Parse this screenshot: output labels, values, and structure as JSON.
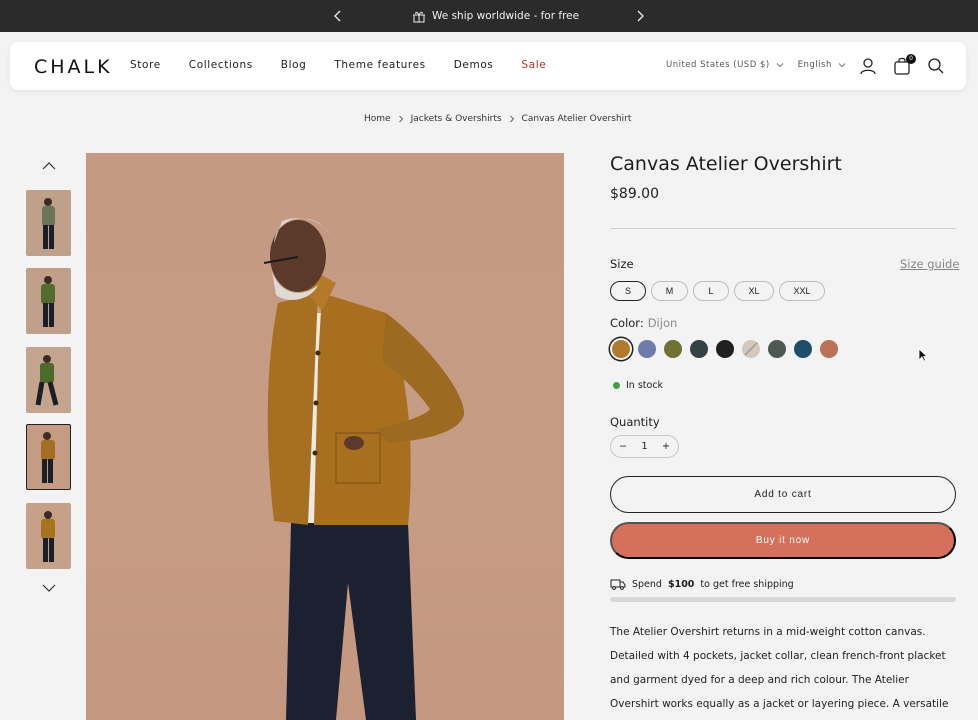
{
  "announcement": {
    "text": "We ship worldwide - for free"
  },
  "header": {
    "logo": "CHALK",
    "nav": [
      "Store",
      "Collections",
      "Blog",
      "Theme features",
      "Demos",
      "Sale"
    ],
    "currency": "United States (USD $)",
    "language": "English",
    "cart_count": "0"
  },
  "breadcrumb": [
    "Home",
    "Jackets & Overshirts",
    "Canvas Atelier Overshirt"
  ],
  "product": {
    "title": "Canvas Atelier Overshirt",
    "price": "$89.00",
    "size_label": "Size",
    "size_guide": "Size guide",
    "sizes": [
      "S",
      "M",
      "L",
      "XL",
      "XXL"
    ],
    "selected_size": "S",
    "color_label": "Color:",
    "color_value": "Dijon",
    "swatches": [
      "#b27a2c",
      "#6f7aad",
      "#6f7232",
      "#334345",
      "#202020",
      "#c6bcb2",
      "#4b5a52",
      "#1f4d6c",
      "#bb7156"
    ],
    "stock": "In stock",
    "quantity_label": "Quantity",
    "quantity": "1",
    "add_to_cart": "Add to cart",
    "buy_now": "Buy it now",
    "shipping_pre": "Spend",
    "shipping_amount": "$100",
    "shipping_post": "to get free shipping",
    "shipping_progress": 0.0,
    "description": "The Atelier Overshirt returns in a mid-weight cotton canvas. Detailed with 4 pockets, jacket collar, clean french-front placket and garment dyed for a deep and rich colour. The Atelier Overshirt works equally as a jacket or layering piece. A versatile addition. Cut"
  },
  "colors": {
    "accent": "#d4705c",
    "sale": "#b3322d",
    "in_stock": "#43a047"
  }
}
